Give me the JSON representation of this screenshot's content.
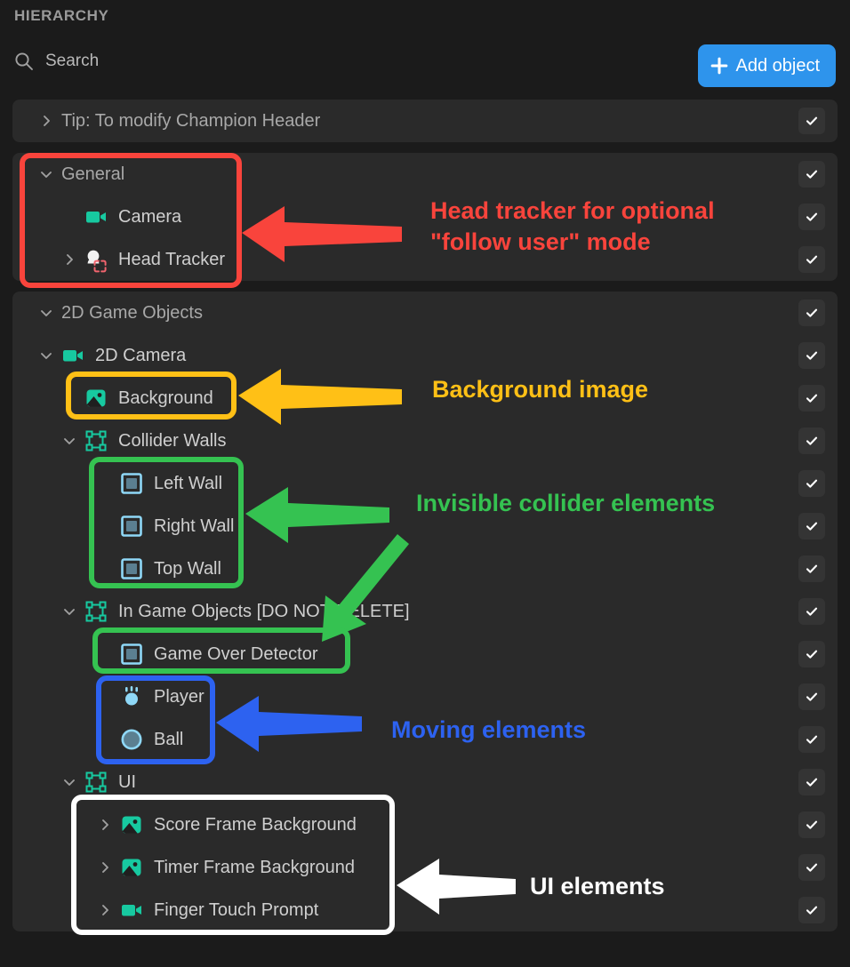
{
  "header": {
    "title": "HIERARCHY",
    "search_placeholder": "Search",
    "search_value": "",
    "search_icon": "search-icon",
    "add_button_label": "Add object",
    "add_button_icon": "plus-icon",
    "add_button_color": "#2e94ec"
  },
  "colors": {
    "panel_bg": "#2a2a2a",
    "page_bg": "#1b1b1b",
    "teal_icon": "#17c9a0",
    "blue_icon": "#8fd8f7",
    "anno_red": "#f9443c",
    "anno_yellow": "#ffc016",
    "anno_green": "#35c251",
    "anno_blue": "#2d62f0",
    "anno_white": "#ffffff"
  },
  "tree": [
    {
      "id": "tip",
      "rows": [
        {
          "name": "Tip: To modify Champion Header",
          "chevron": "right",
          "indent": 0,
          "icon": null,
          "kind": "group",
          "checked": true
        }
      ]
    },
    {
      "id": "general",
      "rows": [
        {
          "name": "General",
          "chevron": "down",
          "indent": 0,
          "icon": null,
          "kind": "group",
          "checked": true
        },
        {
          "name": "Camera",
          "chevron": "none",
          "indent": 1,
          "icon": "camera-icon",
          "kind": "item",
          "checked": true
        },
        {
          "name": "Head Tracker",
          "chevron": "right",
          "indent": 1,
          "icon": "head-tracker-icon",
          "kind": "item",
          "checked": true
        }
      ]
    },
    {
      "id": "2d-game-objects",
      "rows": [
        {
          "name": "2D Game Objects",
          "chevron": "down",
          "indent": 0,
          "icon": null,
          "kind": "group",
          "checked": true
        },
        {
          "name": "2D Camera",
          "chevron": "down",
          "indent": 0,
          "icon": "camera-icon",
          "kind": "item",
          "checked": true
        },
        {
          "name": "Background",
          "chevron": "none",
          "indent": 1,
          "icon": "image-icon",
          "kind": "item",
          "checked": true
        },
        {
          "name": "Collider Walls",
          "chevron": "down",
          "indent": 1,
          "icon": "group-nodes-icon",
          "kind": "item",
          "checked": true
        },
        {
          "name": "Left Wall",
          "chevron": "none",
          "indent": 2,
          "icon": "square-collider-icon",
          "kind": "item",
          "checked": true
        },
        {
          "name": "Right Wall",
          "chevron": "none",
          "indent": 2,
          "icon": "square-collider-icon",
          "kind": "item",
          "checked": true
        },
        {
          "name": "Top Wall",
          "chevron": "none",
          "indent": 2,
          "icon": "square-collider-icon",
          "kind": "item",
          "checked": true
        },
        {
          "name": "In Game Objects [DO NOT DELETE]",
          "chevron": "down",
          "indent": 1,
          "icon": "group-nodes-icon",
          "kind": "item",
          "checked": true
        },
        {
          "name": "Game Over Detector",
          "chevron": "none",
          "indent": 2,
          "icon": "square-collider-icon",
          "kind": "item",
          "checked": true
        },
        {
          "name": "Player",
          "chevron": "none",
          "indent": 2,
          "icon": "player-icon",
          "kind": "item",
          "checked": true
        },
        {
          "name": "Ball",
          "chevron": "none",
          "indent": 2,
          "icon": "ball-icon",
          "kind": "item",
          "checked": true
        },
        {
          "name": "UI",
          "chevron": "down",
          "indent": 1,
          "icon": "group-nodes-icon",
          "kind": "item",
          "checked": true
        },
        {
          "name": "Score Frame Background",
          "chevron": "right",
          "indent": 2,
          "icon": "image-icon",
          "kind": "item",
          "checked": true
        },
        {
          "name": "Timer Frame Background",
          "chevron": "right",
          "indent": 2,
          "icon": "image-icon",
          "kind": "item",
          "checked": true
        },
        {
          "name": "Finger Touch Prompt",
          "chevron": "right",
          "indent": 2,
          "icon": "camera-icon",
          "kind": "item",
          "checked": true
        }
      ]
    }
  ],
  "annotations": [
    {
      "id": "head-tracker",
      "text": "Head tracker for optional\n\"follow user\" mode",
      "color": "#f9443c"
    },
    {
      "id": "background-image",
      "text": "Background image",
      "color": "#ffc016"
    },
    {
      "id": "invisible-colliders",
      "text": "Invisible collider elements",
      "color": "#35c251"
    },
    {
      "id": "moving-elements",
      "text": "Moving elements",
      "color": "#2d62f0"
    },
    {
      "id": "ui-elements",
      "text": "UI elements",
      "color": "#ffffff"
    }
  ]
}
